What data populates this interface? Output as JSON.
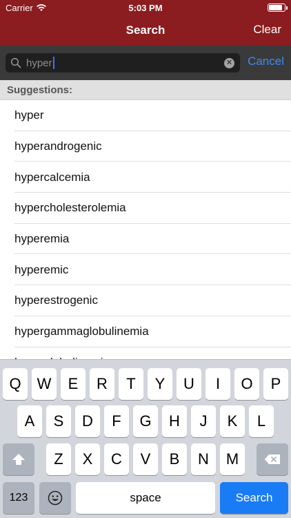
{
  "status": {
    "carrier": "Carrier",
    "time": "5:03 PM"
  },
  "nav": {
    "title": "Search",
    "clear_label": "Clear"
  },
  "search": {
    "query": "hyper",
    "cancel_label": "Cancel"
  },
  "suggestions": {
    "header": "Suggestions:",
    "items": [
      "hyper",
      "hyperandrogenic",
      "hypercalcemia",
      "hypercholesterolemia",
      "hyperemia",
      "hyperemic",
      "hyperestrogenic",
      "hypergammaglobulinemia",
      "hyperglobulinemia"
    ]
  },
  "keyboard": {
    "row1": [
      "Q",
      "W",
      "E",
      "R",
      "T",
      "Y",
      "U",
      "I",
      "O",
      "P"
    ],
    "row2": [
      "A",
      "S",
      "D",
      "F",
      "G",
      "H",
      "J",
      "K",
      "L"
    ],
    "row3": [
      "Z",
      "X",
      "C",
      "V",
      "B",
      "N",
      "M"
    ],
    "num_label": "123",
    "space_label": "space",
    "search_label": "Search"
  },
  "colors": {
    "nav_bg": "#8b1c1f",
    "accent": "#3b8cf4",
    "search_key": "#1a7cf4"
  }
}
